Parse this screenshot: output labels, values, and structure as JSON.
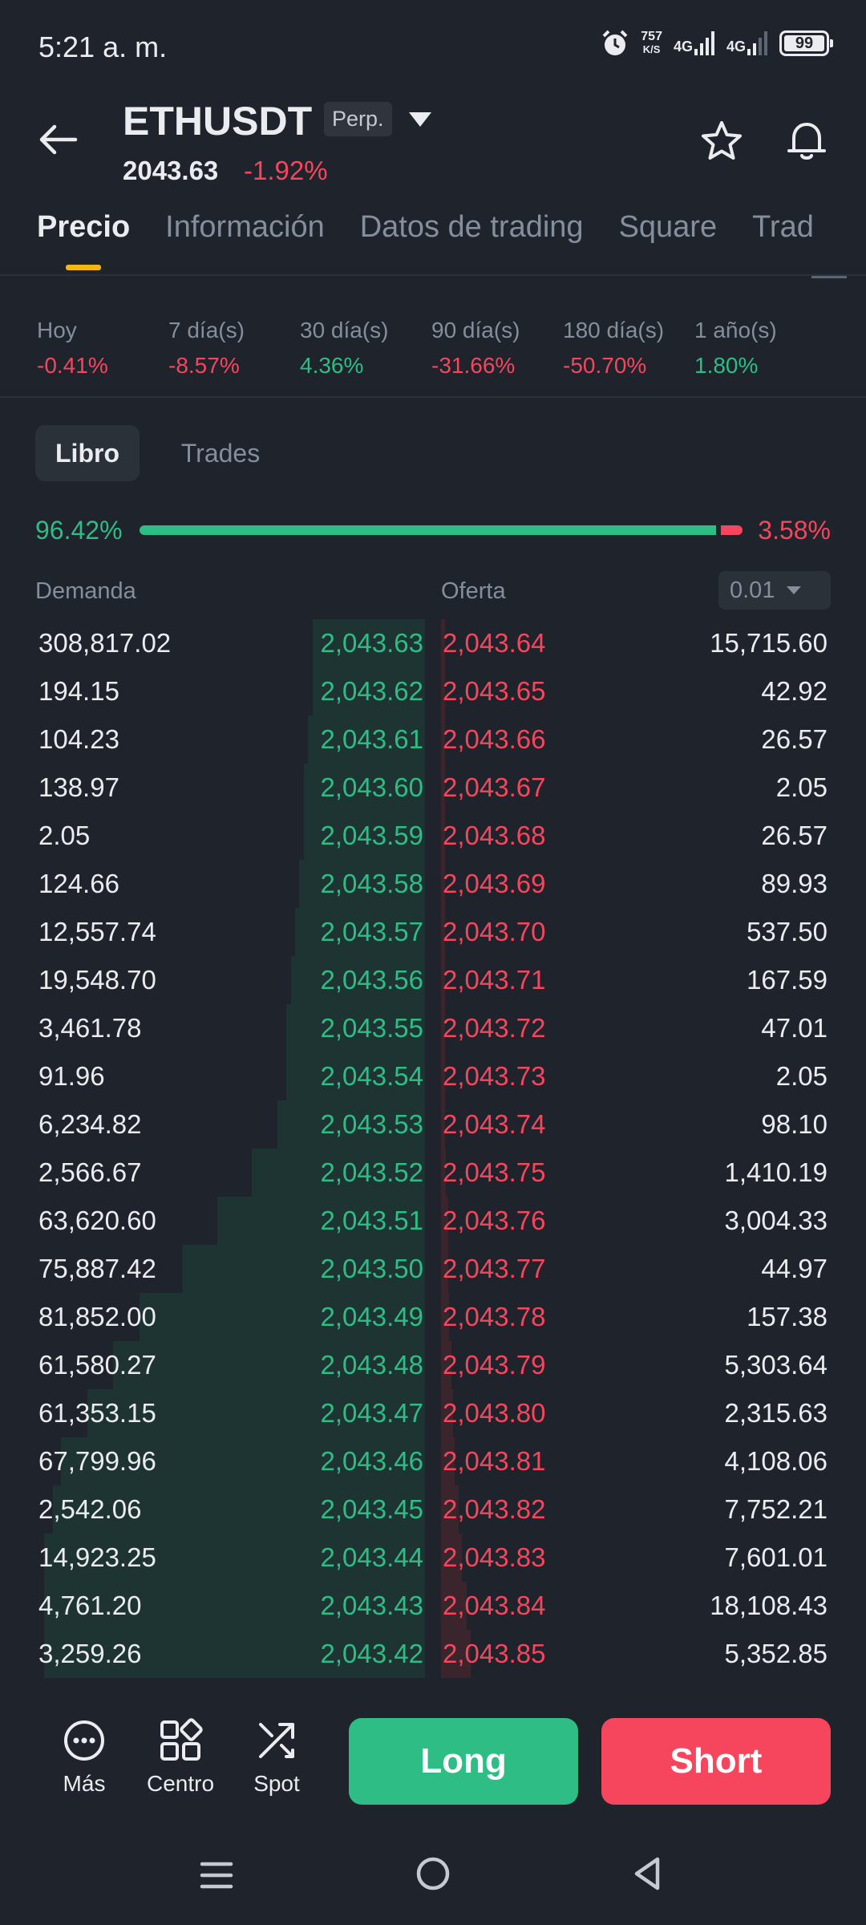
{
  "status_bar": {
    "time": "5:21 a. m.",
    "net_speed_value": "757",
    "net_speed_unit": "K/S",
    "signal_1": "4G",
    "signal_2": "4G",
    "battery": "99"
  },
  "header": {
    "symbol": "ETHUSDT",
    "contract_badge": "Perp.",
    "last_price": "2043.63",
    "change_pct": "-1.92%"
  },
  "tabs": [
    "Precio",
    "Información",
    "Datos de trading",
    "Square",
    "Trad"
  ],
  "performance": [
    {
      "label": "Hoy",
      "value": "-0.41%",
      "dir": "neg"
    },
    {
      "label": "7 día(s)",
      "value": "-8.57%",
      "dir": "neg"
    },
    {
      "label": "30 día(s)",
      "value": "4.36%",
      "dir": "pos"
    },
    {
      "label": "90 día(s)",
      "value": "-31.66%",
      "dir": "neg"
    },
    {
      "label": "180 día(s)",
      "value": "-50.70%",
      "dir": "neg"
    },
    {
      "label": "1 año(s)",
      "value": "1.80%",
      "dir": "pos"
    }
  ],
  "segment": {
    "active": "Libro",
    "inactive": "Trades"
  },
  "ratio": {
    "bid_label": "96.42%",
    "ask_label": "3.58%",
    "bid_fraction": 0.9642
  },
  "book_header": {
    "bid": "Demanda",
    "ask": "Oferta",
    "tick_size": "0.01"
  },
  "order_book": [
    {
      "bid_qty": "308,817.02",
      "bid_price": "2,043.63",
      "ask_price": "2,043.64",
      "ask_qty": "15,715.60",
      "bid_depth": 0.13,
      "ask_depth": 0.005
    },
    {
      "bid_qty": "194.15",
      "bid_price": "2,043.62",
      "ask_price": "2,043.65",
      "ask_qty": "42.92",
      "bid_depth": 0.13,
      "ask_depth": 0.005
    },
    {
      "bid_qty": "104.23",
      "bid_price": "2,043.61",
      "ask_price": "2,043.66",
      "ask_qty": "26.57",
      "bid_depth": 0.135,
      "ask_depth": 0.005
    },
    {
      "bid_qty": "138.97",
      "bid_price": "2,043.60",
      "ask_price": "2,043.67",
      "ask_qty": "2.05",
      "bid_depth": 0.14,
      "ask_depth": 0.005
    },
    {
      "bid_qty": "2.05",
      "bid_price": "2,043.59",
      "ask_price": "2,043.68",
      "ask_qty": "26.57",
      "bid_depth": 0.14,
      "ask_depth": 0.005
    },
    {
      "bid_qty": "124.66",
      "bid_price": "2,043.58",
      "ask_price": "2,043.69",
      "ask_qty": "89.93",
      "bid_depth": 0.145,
      "ask_depth": 0.005
    },
    {
      "bid_qty": "12,557.74",
      "bid_price": "2,043.57",
      "ask_price": "2,043.70",
      "ask_qty": "537.50",
      "bid_depth": 0.15,
      "ask_depth": 0.005
    },
    {
      "bid_qty": "19,548.70",
      "bid_price": "2,043.56",
      "ask_price": "2,043.71",
      "ask_qty": "167.59",
      "bid_depth": 0.155,
      "ask_depth": 0.005
    },
    {
      "bid_qty": "3,461.78",
      "bid_price": "2,043.55",
      "ask_price": "2,043.72",
      "ask_qty": "47.01",
      "bid_depth": 0.16,
      "ask_depth": 0.005
    },
    {
      "bid_qty": "91.96",
      "bid_price": "2,043.54",
      "ask_price": "2,043.73",
      "ask_qty": "2.05",
      "bid_depth": 0.16,
      "ask_depth": 0.005
    },
    {
      "bid_qty": "6,234.82",
      "bid_price": "2,043.53",
      "ask_price": "2,043.74",
      "ask_qty": "98.10",
      "bid_depth": 0.17,
      "ask_depth": 0.005
    },
    {
      "bid_qty": "2,566.67",
      "bid_price": "2,043.52",
      "ask_price": "2,043.75",
      "ask_qty": "1,410.19",
      "bid_depth": 0.2,
      "ask_depth": 0.006
    },
    {
      "bid_qty": "63,620.60",
      "bid_price": "2,043.51",
      "ask_price": "2,043.76",
      "ask_qty": "3,004.33",
      "bid_depth": 0.24,
      "ask_depth": 0.008
    },
    {
      "bid_qty": "75,887.42",
      "bid_price": "2,043.50",
      "ask_price": "2,043.77",
      "ask_qty": "44.97",
      "bid_depth": 0.28,
      "ask_depth": 0.008
    },
    {
      "bid_qty": "81,852.00",
      "bid_price": "2,043.49",
      "ask_price": "2,043.78",
      "ask_qty": "157.38",
      "bid_depth": 0.33,
      "ask_depth": 0.009
    },
    {
      "bid_qty": "61,580.27",
      "bid_price": "2,043.48",
      "ask_price": "2,043.79",
      "ask_qty": "5,303.64",
      "bid_depth": 0.36,
      "ask_depth": 0.012
    },
    {
      "bid_qty": "61,353.15",
      "bid_price": "2,043.47",
      "ask_price": "2,043.80",
      "ask_qty": "2,315.63",
      "bid_depth": 0.39,
      "ask_depth": 0.014
    },
    {
      "bid_qty": "67,799.96",
      "bid_price": "2,043.46",
      "ask_price": "2,043.81",
      "ask_qty": "4,108.06",
      "bid_depth": 0.42,
      "ask_depth": 0.016
    },
    {
      "bid_qty": "2,542.06",
      "bid_price": "2,043.45",
      "ask_price": "2,043.82",
      "ask_qty": "7,752.21",
      "bid_depth": 0.43,
      "ask_depth": 0.02
    },
    {
      "bid_qty": "14,923.25",
      "bid_price": "2,043.44",
      "ask_price": "2,043.83",
      "ask_qty": "7,601.01",
      "bid_depth": 0.44,
      "ask_depth": 0.024
    },
    {
      "bid_qty": "4,761.20",
      "bid_price": "2,043.43",
      "ask_price": "2,043.84",
      "ask_qty": "18,108.43",
      "bid_depth": 0.44,
      "ask_depth": 0.03
    },
    {
      "bid_qty": "3,259.26",
      "bid_price": "2,043.42",
      "ask_price": "2,043.85",
      "ask_qty": "5,352.85",
      "bid_depth": 0.44,
      "ask_depth": 0.034
    }
  ],
  "actions": {
    "more": "Más",
    "center": "Centro",
    "spot": "Spot",
    "long": "Long",
    "short": "Short"
  },
  "colors": {
    "bid": "#2ebd85",
    "ask": "#f6465d",
    "accent": "#f0b90b",
    "background": "#1f232b"
  }
}
